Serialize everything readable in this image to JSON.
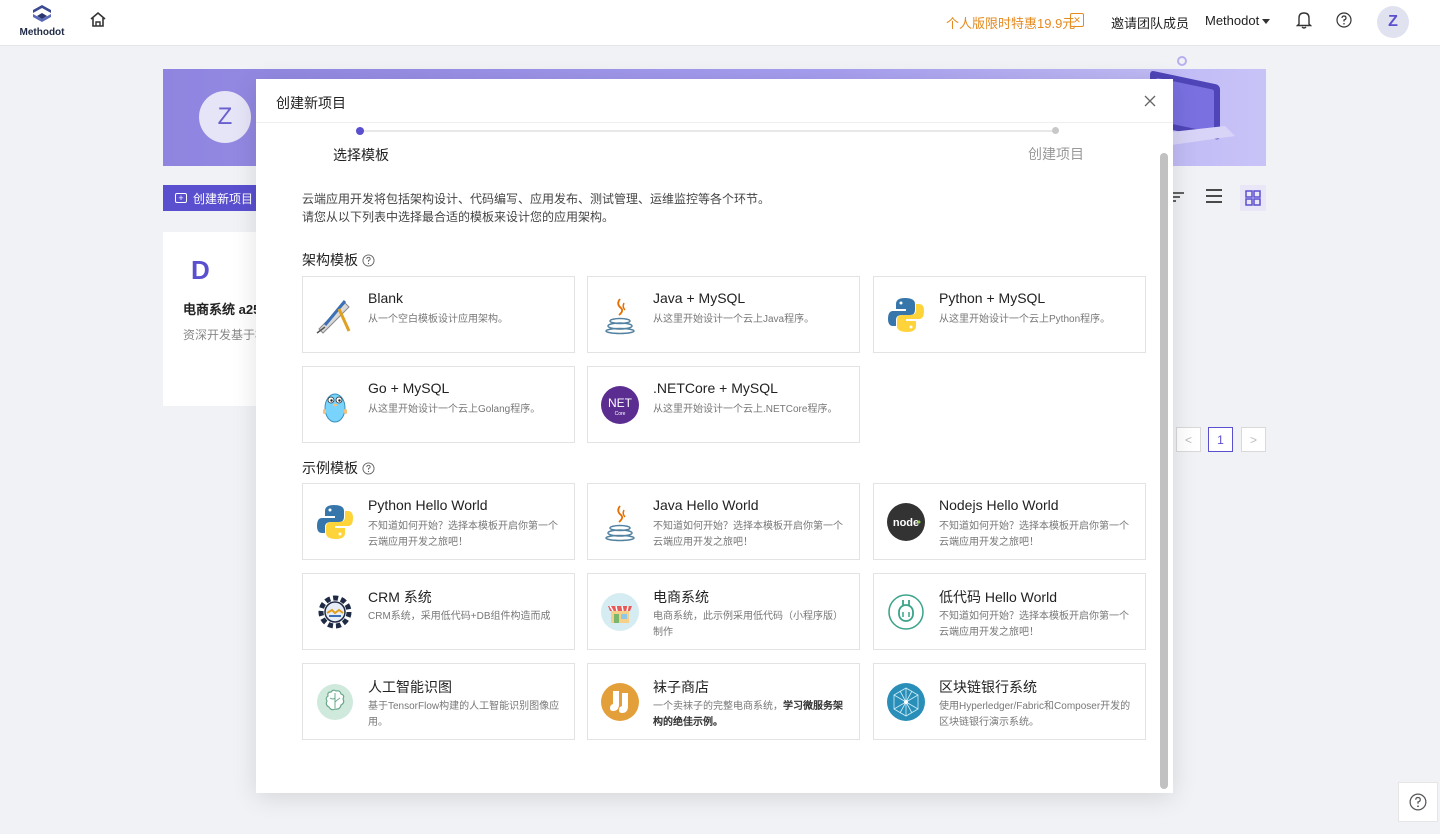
{
  "topbar": {
    "logo_text": "Methodot",
    "promo": "个人版限时特惠19.9元",
    "promo_badge": "✕",
    "invite": "邀请团队成员",
    "team": "Methodot",
    "avatar": "Z"
  },
  "background": {
    "banner_avatar": "Z",
    "new_project": "创建新项目",
    "card_letter": "D",
    "card_title": "电商系统 a25",
    "card_desc": "资深开发基于模板",
    "pager_prev": "<",
    "pager_current": "1",
    "pager_next": ">"
  },
  "modal": {
    "title": "创建新项目",
    "steps": [
      {
        "label": "选择模板"
      },
      {
        "label": "创建项目"
      }
    ],
    "intro_line1": "云端应用开发将包括架构设计、代码编写、应用发布、测试管理、运维监控等各个环节。",
    "intro_line2": "请您从以下列表中选择最合适的模板来设计您的应用架构。",
    "arch_section": "架构模板",
    "example_section": "示例模板",
    "arch_templates": [
      {
        "title": "Blank",
        "desc": "从一个空白模板设计应用架构。",
        "icon": "blank-drafting-icon"
      },
      {
        "title": "Java + MySQL",
        "desc": "从这里开始设计一个云上Java程序。",
        "icon": "java-icon"
      },
      {
        "title": "Python + MySQL",
        "desc": "从这里开始设计一个云上Python程序。",
        "icon": "python-icon"
      },
      {
        "title": "Go + MySQL",
        "desc": "从这里开始设计一个云上Golang程序。",
        "icon": "go-gopher-icon"
      },
      {
        "title": ".NETCore + MySQL",
        "desc": "从这里开始设计一个云上.NETCore程序。",
        "icon": "dotnet-icon"
      }
    ],
    "example_templates": [
      {
        "title": "Python Hello World",
        "desc": "不知道如何开始？选择本模板开启你第一个云端应用开发之旅吧！",
        "icon": "python-icon"
      },
      {
        "title": "Java Hello World",
        "desc": "不知道如何开始？选择本模板开启你第一个云端应用开发之旅吧！",
        "icon": "java-icon"
      },
      {
        "title": "Nodejs Hello World",
        "desc": "不知道如何开始？选择本模板开启你第一个云端应用开发之旅吧！",
        "icon": "nodejs-icon"
      },
      {
        "title": "CRM 系统",
        "desc": "CRM系统，采用低代码+DB组件构造而成",
        "icon": "crm-gear-icon"
      },
      {
        "title": "电商系统",
        "desc": "电商系统，此示例采用低代码（小程序版）制作",
        "icon": "shop-icon"
      },
      {
        "title": "低代码 Hello World",
        "desc": "不知道如何开始？选择本模板开启你第一个云端应用开发之旅吧！",
        "icon": "plug-icon"
      },
      {
        "title": "人工智能识图",
        "desc": "基于TensorFlow构建的人工智能识别图像应用。",
        "icon": "brain-icon"
      },
      {
        "title": "袜子商店",
        "desc_plain": "一个卖袜子的完整电商系统，",
        "desc_bold": "学习微服务架构的绝佳示例。",
        "icon": "socks-icon"
      },
      {
        "title": "区块链银行系统",
        "desc": "使用Hyperledger/Fabric和Composer开发的区块链银行演示系统。",
        "icon": "blockchain-icon"
      }
    ]
  },
  "colors": {
    "accent": "#5a4fcf",
    "promo": "#e58a1f"
  }
}
